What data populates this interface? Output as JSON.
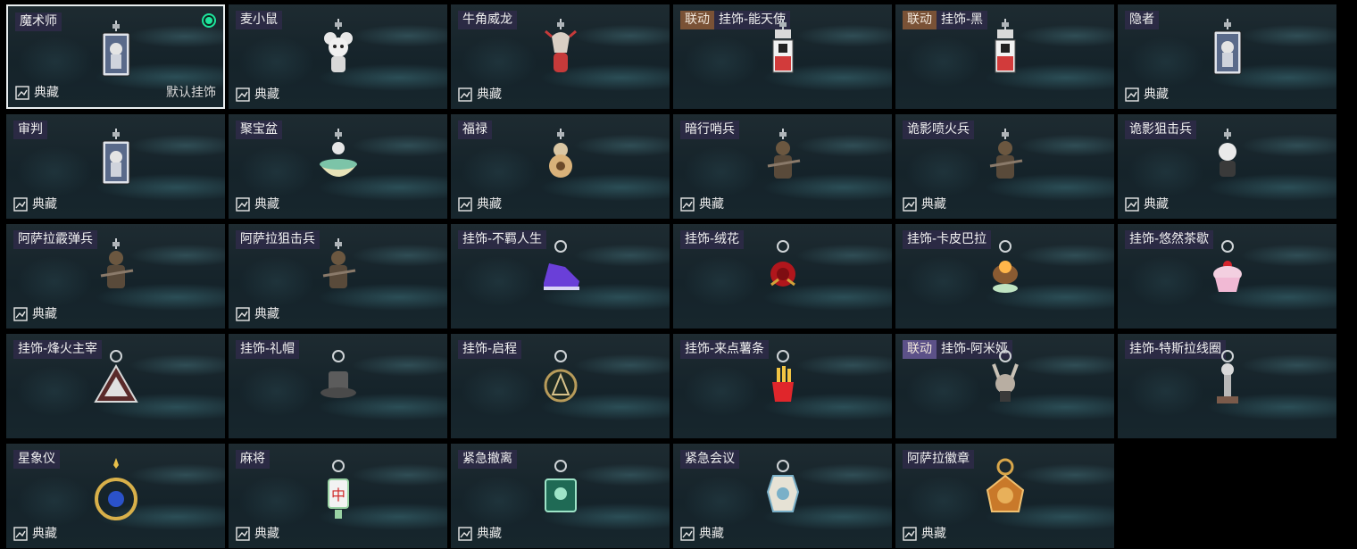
{
  "collection_label": "典藏",
  "default_label": "默认挂饰",
  "items": [
    {
      "name": "魔术师",
      "tag": "",
      "tag_color": "",
      "selected": true,
      "collection": true,
      "default": true,
      "icon": "tarot-card-charm-icon"
    },
    {
      "name": "麦小鼠",
      "tag": "",
      "tag_color": "",
      "selected": false,
      "collection": true,
      "default": false,
      "icon": "mouse-figure-charm-icon"
    },
    {
      "name": "牛角威龙",
      "tag": "",
      "tag_color": "",
      "selected": false,
      "collection": true,
      "default": false,
      "icon": "horned-figure-charm-icon"
    },
    {
      "name": "挂饰-能天使",
      "tag": "联动",
      "tag_color": "#7a5236",
      "selected": false,
      "collection": false,
      "default": false,
      "icon": "red-tag-charm-icon"
    },
    {
      "name": "挂饰-黑",
      "tag": "联动",
      "tag_color": "#7a5236",
      "selected": false,
      "collection": false,
      "default": false,
      "icon": "red-tag-charm-icon"
    },
    {
      "name": "隐者",
      "tag": "",
      "tag_color": "",
      "selected": false,
      "collection": true,
      "default": false,
      "icon": "tarot-card-charm-icon"
    },
    {
      "name": "审判",
      "tag": "",
      "tag_color": "",
      "selected": false,
      "collection": true,
      "default": false,
      "icon": "tarot-card-charm-icon"
    },
    {
      "name": "聚宝盆",
      "tag": "",
      "tag_color": "",
      "selected": false,
      "collection": true,
      "default": false,
      "icon": "treasure-bowl-charm-icon"
    },
    {
      "name": "福禄",
      "tag": "",
      "tag_color": "",
      "selected": false,
      "collection": true,
      "default": false,
      "icon": "gourd-charm-icon"
    },
    {
      "name": "暗行哨兵",
      "tag": "",
      "tag_color": "",
      "selected": false,
      "collection": true,
      "default": false,
      "icon": "soldier-figure-charm-icon"
    },
    {
      "name": "诡影喷火兵",
      "tag": "",
      "tag_color": "",
      "selected": false,
      "collection": true,
      "default": false,
      "icon": "soldier-figure-charm-icon"
    },
    {
      "name": "诡影狙击兵",
      "tag": "",
      "tag_color": "",
      "selected": false,
      "collection": true,
      "default": false,
      "icon": "masked-figure-charm-icon"
    },
    {
      "name": "阿萨拉霰弹兵",
      "tag": "",
      "tag_color": "",
      "selected": false,
      "collection": true,
      "default": false,
      "icon": "soldier-figure-charm-icon"
    },
    {
      "name": "阿萨拉狙击兵",
      "tag": "",
      "tag_color": "",
      "selected": false,
      "collection": true,
      "default": false,
      "icon": "soldier-figure-charm-icon"
    },
    {
      "name": "挂饰-不羁人生",
      "tag": "",
      "tag_color": "",
      "selected": false,
      "collection": false,
      "default": false,
      "icon": "sneaker-charm-icon"
    },
    {
      "name": "挂饰-绒花",
      "tag": "",
      "tag_color": "",
      "selected": false,
      "collection": false,
      "default": false,
      "icon": "rose-charm-icon"
    },
    {
      "name": "挂饰-卡皮巴拉",
      "tag": "",
      "tag_color": "",
      "selected": false,
      "collection": false,
      "default": false,
      "icon": "capybara-charm-icon"
    },
    {
      "name": "挂饰-悠然茶歇",
      "tag": "",
      "tag_color": "",
      "selected": false,
      "collection": false,
      "default": false,
      "icon": "cupcake-charm-icon"
    },
    {
      "name": "挂饰-烽火主宰",
      "tag": "",
      "tag_color": "",
      "selected": false,
      "collection": false,
      "default": false,
      "icon": "triangle-emblem-charm-icon"
    },
    {
      "name": "挂饰-礼帽",
      "tag": "",
      "tag_color": "",
      "selected": false,
      "collection": false,
      "default": false,
      "icon": "top-hat-charm-icon"
    },
    {
      "name": "挂饰-启程",
      "tag": "",
      "tag_color": "",
      "selected": false,
      "collection": false,
      "default": false,
      "icon": "round-emblem-charm-icon"
    },
    {
      "name": "挂饰-来点薯条",
      "tag": "",
      "tag_color": "",
      "selected": false,
      "collection": false,
      "default": false,
      "icon": "fries-charm-icon"
    },
    {
      "name": "挂饰-阿米娅",
      "tag": "联动",
      "tag_color": "#5c5188",
      "selected": false,
      "collection": false,
      "default": false,
      "icon": "bunny-figure-charm-icon"
    },
    {
      "name": "挂饰-特斯拉线圈",
      "tag": "",
      "tag_color": "",
      "selected": false,
      "collection": false,
      "default": false,
      "icon": "tesla-coil-charm-icon"
    },
    {
      "name": "星象仪",
      "tag": "",
      "tag_color": "",
      "selected": false,
      "collection": true,
      "default": false,
      "icon": "orrery-charm-icon"
    },
    {
      "name": "麻将",
      "tag": "",
      "tag_color": "",
      "selected": false,
      "collection": true,
      "default": false,
      "icon": "mahjong-tile-charm-icon"
    },
    {
      "name": "紧急撤离",
      "tag": "",
      "tag_color": "",
      "selected": false,
      "collection": true,
      "default": false,
      "icon": "green-sign-charm-icon"
    },
    {
      "name": "紧急会议",
      "tag": "",
      "tag_color": "",
      "selected": false,
      "collection": true,
      "default": false,
      "icon": "vase-charm-icon"
    },
    {
      "name": "阿萨拉徽章",
      "tag": "",
      "tag_color": "",
      "selected": false,
      "collection": true,
      "default": false,
      "icon": "medal-charm-icon"
    }
  ]
}
